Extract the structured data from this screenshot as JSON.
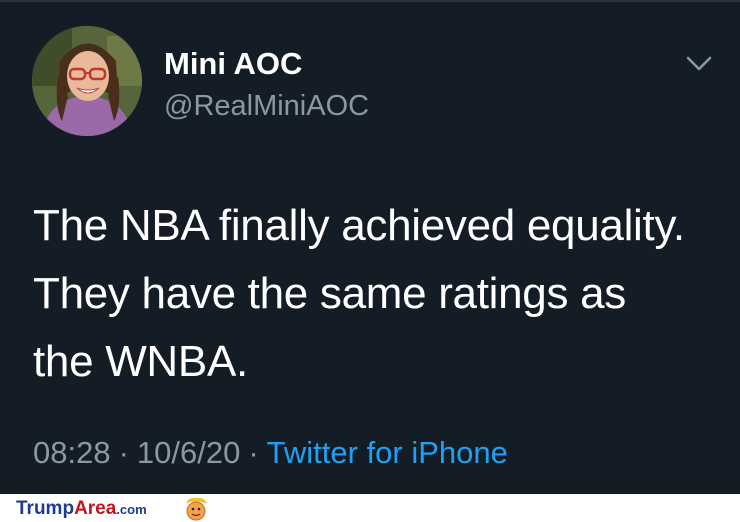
{
  "tweet": {
    "display_name": "Mini AOC",
    "handle": "@RealMiniAOC",
    "text_lines": [
      "The NBA finally achieved equality.",
      "They have the same ratings as",
      "the WNBA."
    ],
    "time": "08:28",
    "date": "10/6/20",
    "separator": "·",
    "source": "Twitter for iPhone",
    "menu_icon": "chevron-down-icon"
  },
  "watermark": {
    "part1": "Trump",
    "part2": "Area",
    "part3": ".com",
    "mascot_icon": "cartoon-face-icon"
  },
  "colors": {
    "background": "#141d26",
    "primary_text": "#ffffff",
    "secondary_text": "#8899a6",
    "link": "#1da1f2",
    "brand_blue": "#1d3c8f",
    "brand_red": "#c4161c"
  }
}
